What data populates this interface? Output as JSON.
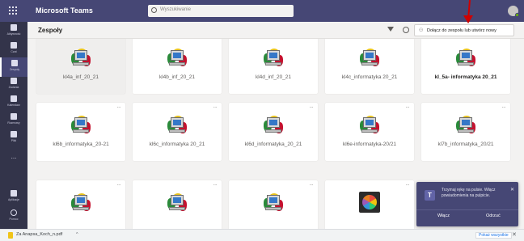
{
  "app": {
    "title": "Microsoft Teams",
    "search_placeholder": "Wyszukiwanie",
    "accent": "#464775"
  },
  "rail": {
    "items": [
      {
        "label": "Aktywność",
        "icon": "bell-icon"
      },
      {
        "label": "Czat",
        "icon": "chat-icon"
      },
      {
        "label": "Zespoły",
        "icon": "teams-icon",
        "active": true
      },
      {
        "label": "Zadania",
        "icon": "assignments-icon"
      },
      {
        "label": "Kalendarz",
        "icon": "calendar-icon"
      },
      {
        "label": "Rozmowy",
        "icon": "phone-icon"
      },
      {
        "label": "Pliki",
        "icon": "files-icon"
      },
      {
        "label": "...",
        "icon": "more-icon"
      },
      {
        "label": "Aplikacje",
        "icon": "apps-icon"
      },
      {
        "label": "Pomoc",
        "icon": "help-icon"
      }
    ]
  },
  "header": {
    "title": "Zespoły",
    "join_button": "Dołącz do zespołu lub utwórz nowy"
  },
  "teams": [
    {
      "name": "kl4a_inf_20_21",
      "icon": "computer-icon",
      "selected": true
    },
    {
      "name": "kl4b_inf_20_21",
      "icon": "computer-icon"
    },
    {
      "name": "kl4d_inf_20_21",
      "icon": "computer-icon"
    },
    {
      "name": "kl4c_informatyka 20_21",
      "icon": "computer-icon"
    },
    {
      "name": "kl_5a- informatyka 20_21",
      "icon": "computer-icon",
      "bold": true
    },
    {
      "name": "kl6b_informatyka_20-21",
      "icon": "computer-icon"
    },
    {
      "name": "kl6c_informatyka 20_21",
      "icon": "computer-icon"
    },
    {
      "name": "kl6d_informatyka_20_21",
      "icon": "computer-icon"
    },
    {
      "name": "kl6e-informatyka-20/21",
      "icon": "computer-icon"
    },
    {
      "name": "kl7b_informatyka_20/21",
      "icon": "computer-icon"
    },
    {
      "name": "",
      "icon": "computer-icon"
    },
    {
      "name": "",
      "icon": "computer-icon"
    },
    {
      "name": "",
      "icon": "computer-icon"
    },
    {
      "name": "",
      "icon": "palette-icon"
    }
  ],
  "more_label": "...",
  "toast": {
    "text": "Trzymaj rękę na pulsie. Włącz powiadomienia na pulpicie.",
    "primary": "Włącz",
    "secondary": "Odrzuć",
    "close": "✕"
  },
  "download": {
    "file": "Za Anapsa_Koch_n.pdf",
    "chevron": "^",
    "show_all": "Pokaż wszystkie",
    "close": "✕"
  }
}
